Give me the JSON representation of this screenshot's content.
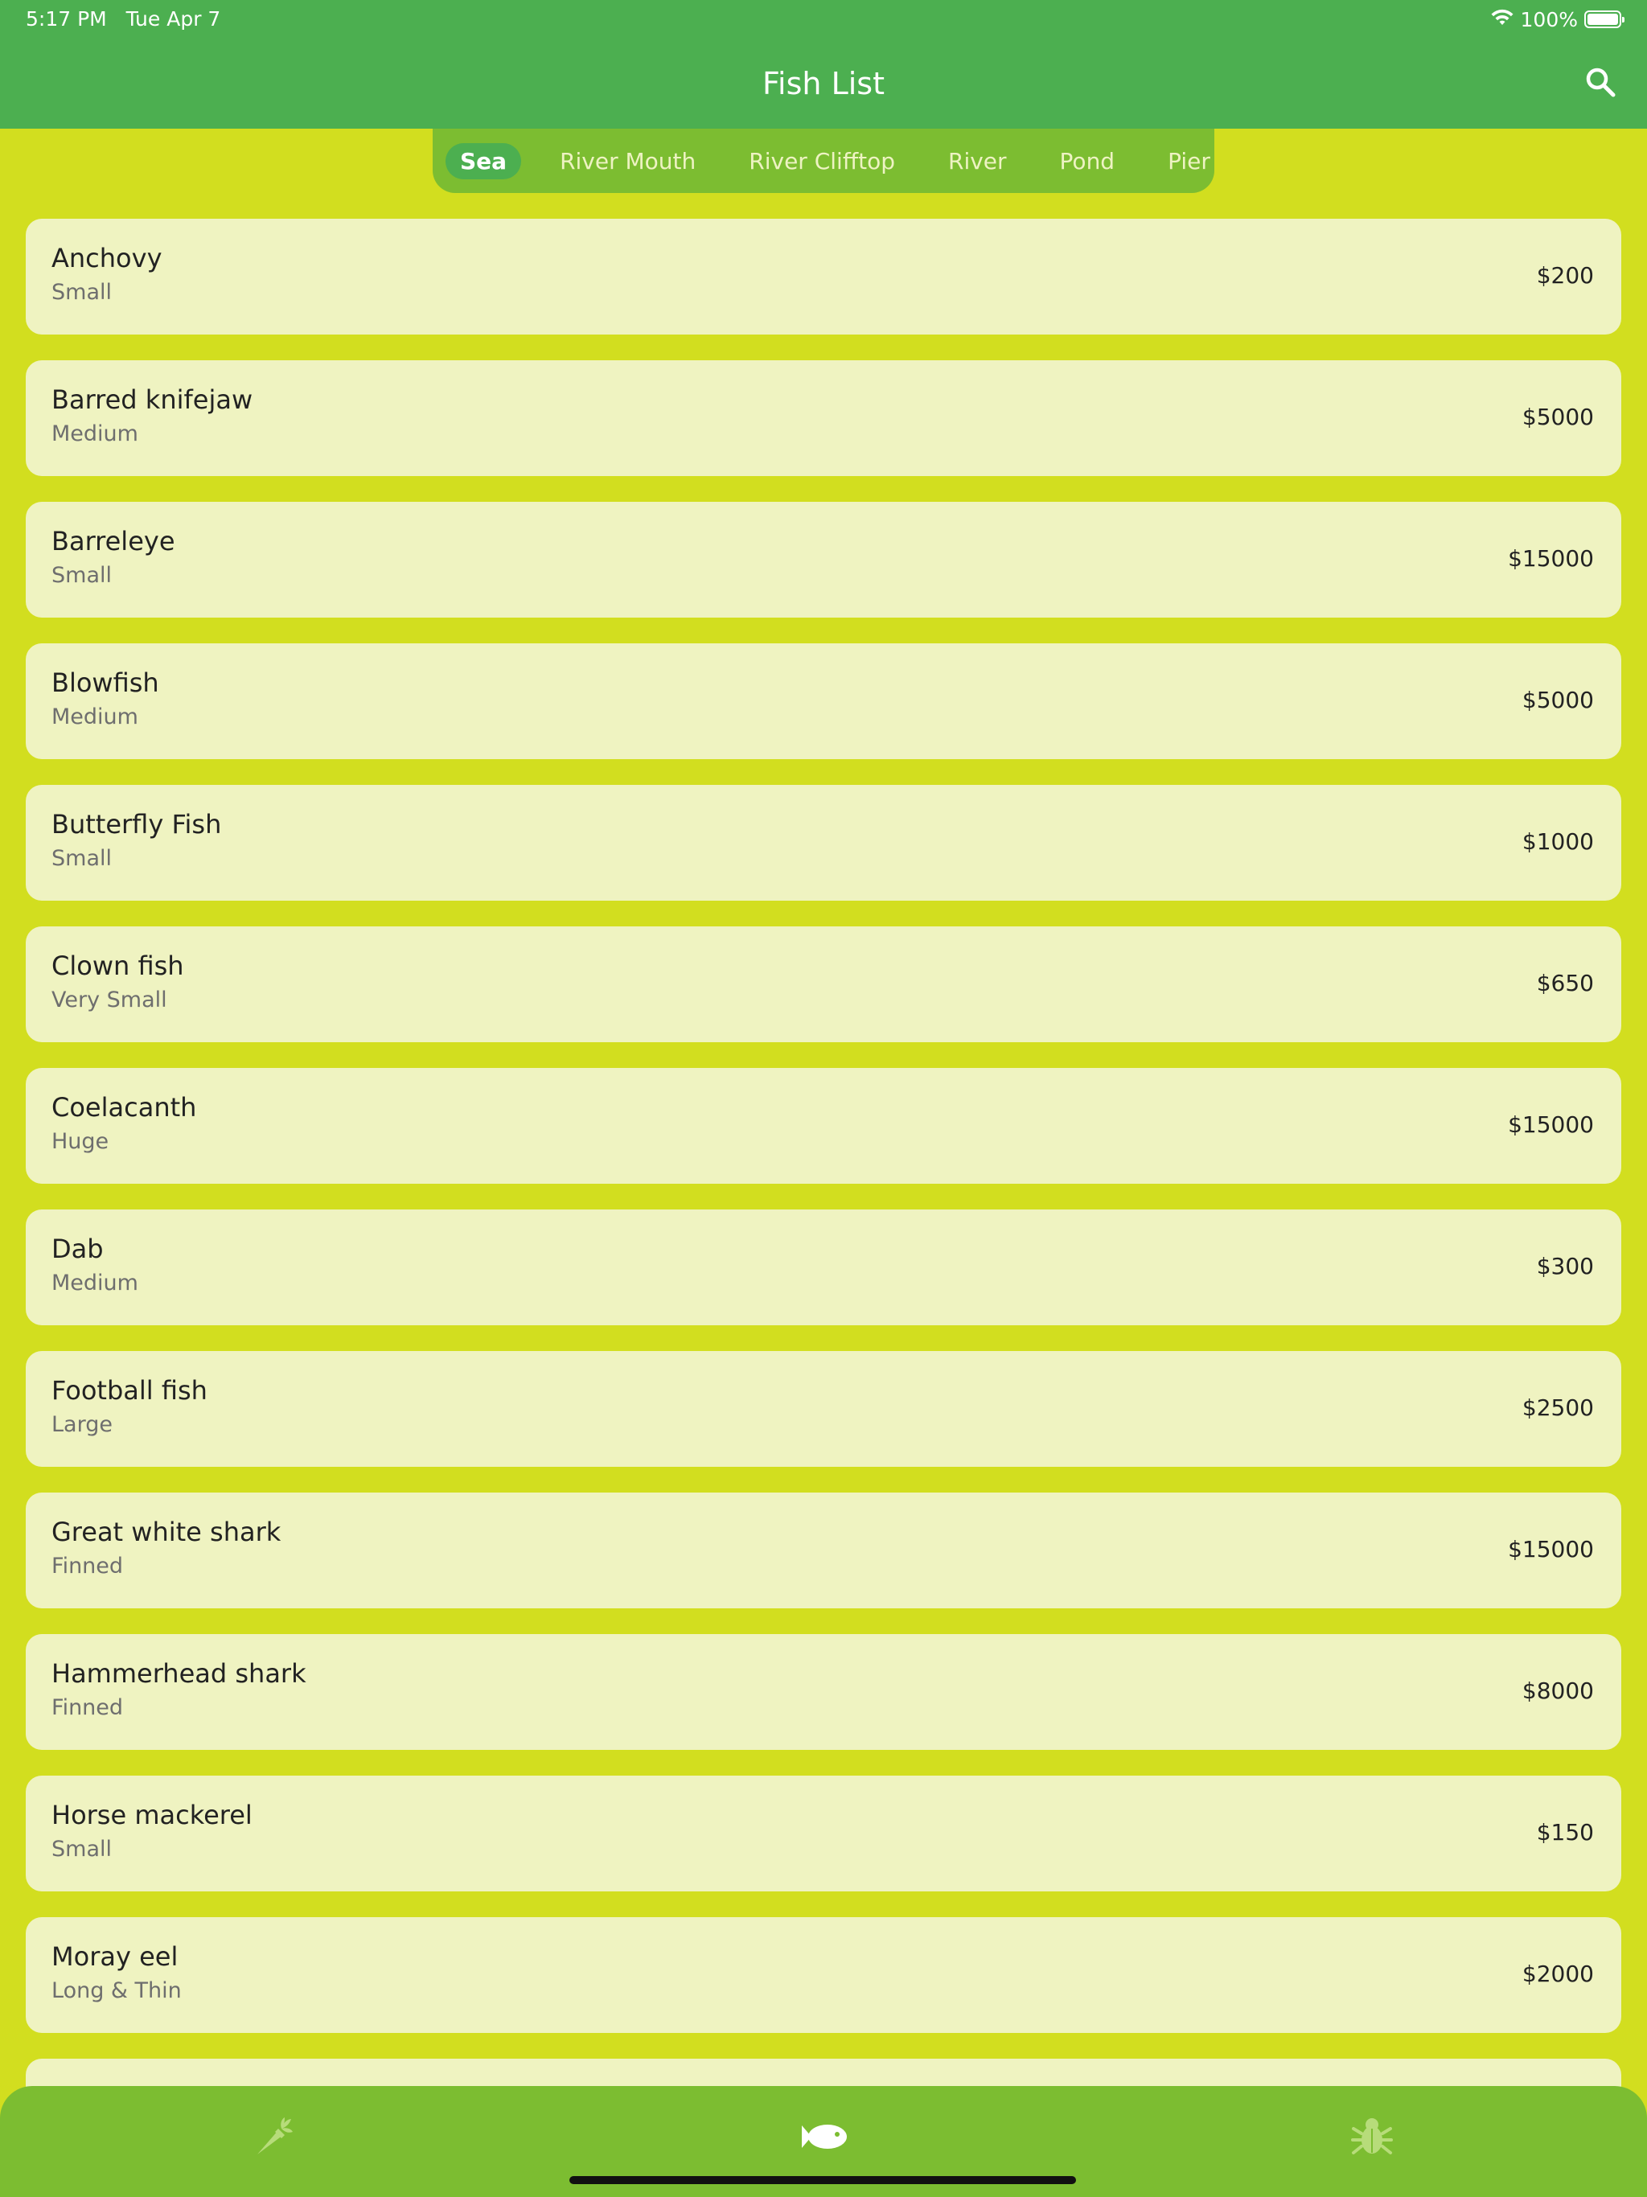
{
  "status_bar": {
    "time": "5:17 PM",
    "date": "Tue Apr 7",
    "battery": "100%"
  },
  "header": {
    "title": "Fish List",
    "search_icon": "search-icon"
  },
  "tabs": [
    {
      "label": "Sea",
      "active": true
    },
    {
      "label": "River Mouth",
      "active": false
    },
    {
      "label": "River Clifftop",
      "active": false
    },
    {
      "label": "River",
      "active": false
    },
    {
      "label": "Pond",
      "active": false
    },
    {
      "label": "Pier",
      "active": false
    }
  ],
  "fish": [
    {
      "name": "Anchovy",
      "size": "Small",
      "price": "$200"
    },
    {
      "name": "Barred knifejaw",
      "size": "Medium",
      "price": "$5000"
    },
    {
      "name": "Barreleye",
      "size": "Small",
      "price": "$15000"
    },
    {
      "name": "Blowfish",
      "size": "Medium",
      "price": "$5000"
    },
    {
      "name": "Butterfly Fish",
      "size": "Small",
      "price": "$1000"
    },
    {
      "name": "Clown fish",
      "size": "Very Small",
      "price": "$650"
    },
    {
      "name": "Coelacanth",
      "size": "Huge",
      "price": "$15000"
    },
    {
      "name": "Dab",
      "size": "Medium",
      "price": "$300"
    },
    {
      "name": "Football fish",
      "size": "Large",
      "price": "$2500"
    },
    {
      "name": "Great white shark",
      "size": "Finned",
      "price": "$15000"
    },
    {
      "name": "Hammerhead shark",
      "size": "Finned",
      "price": "$8000"
    },
    {
      "name": "Horse mackerel",
      "size": "Small",
      "price": "$150"
    },
    {
      "name": "Moray eel",
      "size": "Long & Thin",
      "price": "$2000"
    }
  ],
  "bottom_nav": [
    {
      "icon": "carrot-icon",
      "active": false
    },
    {
      "icon": "fish-icon",
      "active": true
    },
    {
      "icon": "bug-icon",
      "active": false
    }
  ],
  "colors": {
    "header": "#4caf50",
    "background": "#d2de1f",
    "tabs_bar": "#7cbd31",
    "card": "#eff3c1",
    "nav_bar": "#7cbd31"
  }
}
